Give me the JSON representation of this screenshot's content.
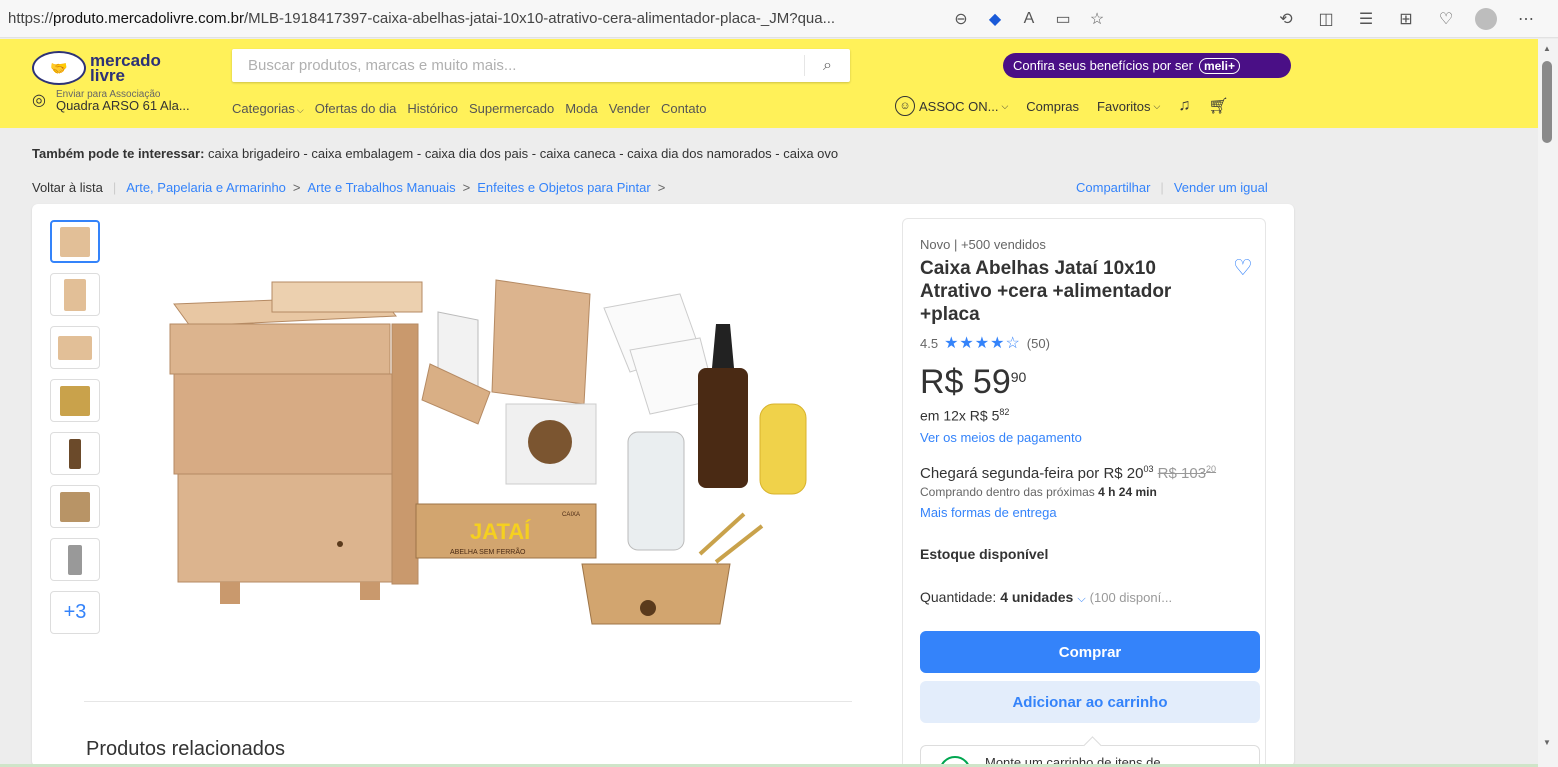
{
  "browser": {
    "url_prefix": "https://",
    "url_domain": "produto.mercadolivre.com.br",
    "url_path": "/MLB-1918417397-caixa-abelhas-jatai-10x10-atrativo-cera-alimentador-placa-_JM?qua..."
  },
  "header": {
    "logo_line1": "mercado",
    "logo_line2": "livre",
    "search_placeholder": "Buscar produtos, marcas e muito mais...",
    "meli_banner": "Confira seus benefícios por ser",
    "meli_tag": "meli+",
    "ship_small": "Enviar para Associação",
    "ship_main": "Quadra ARSO 61 Ala...",
    "nav": [
      "Categorias",
      "Ofertas do dia",
      "Histórico",
      "Supermercado",
      "Moda",
      "Vender",
      "Contato"
    ],
    "user_name": "ASSOC ON...",
    "purchases": "Compras",
    "favorites": "Favoritos"
  },
  "related": {
    "label": "Também pode te interessar:",
    "items": "caixa brigadeiro - caixa embalagem - caixa dia dos pais - caixa caneca - caixa dia dos namorados - caixa ovo"
  },
  "breadcrumb": {
    "back": "Voltar à lista",
    "c1": "Arte, Papelaria e Armarinho",
    "c2": "Arte e Trabalhos Manuais",
    "c3": "Enfeites e Objetos para Pintar",
    "share": "Compartilhar",
    "sell": "Vender um igual"
  },
  "gallery": {
    "more_count": "+3",
    "jatai_label": "JATAÍ",
    "jatai_sub": "ABELHA SEM FERRÃO",
    "jatai_tag": "CAIXA"
  },
  "product": {
    "condition": "Novo  |  +500 vendidos",
    "title": "Caixa Abelhas Jataí 10x10 Atrativo +cera +alimentador +placa",
    "rating_value": "4.5",
    "rating_count": "(50)",
    "price_int": "R$ 59",
    "price_cents": "90",
    "install_prefix": "em 12x R$ 5",
    "install_cents": "82",
    "payment_link": "Ver os meios de pagamento",
    "arrive_text": "Chegará segunda-feira por R$ 20",
    "arrive_cents": "03",
    "arrive_old": "R$ 103",
    "arrive_old_cents": "20",
    "arrive_sub": "Comprando dentro das próximas",
    "arrive_time": "4 h 24 min",
    "more_shipping": "Mais formas de entrega",
    "stock": "Estoque disponível",
    "qty_label": "Quantidade:",
    "qty_value": "4 unidades",
    "qty_avail": "(100 disponí...",
    "buy_button": "Comprar",
    "cart_button": "Adicionar ao carrinho",
    "tooltip_text": "Monte um carrinho de itens de"
  },
  "section": {
    "related_products": "Produtos relacionados"
  },
  "colors": {
    "brand_yellow": "#fff159",
    "accent_blue": "#3483fa",
    "meli_purple": "#4a0f86"
  }
}
